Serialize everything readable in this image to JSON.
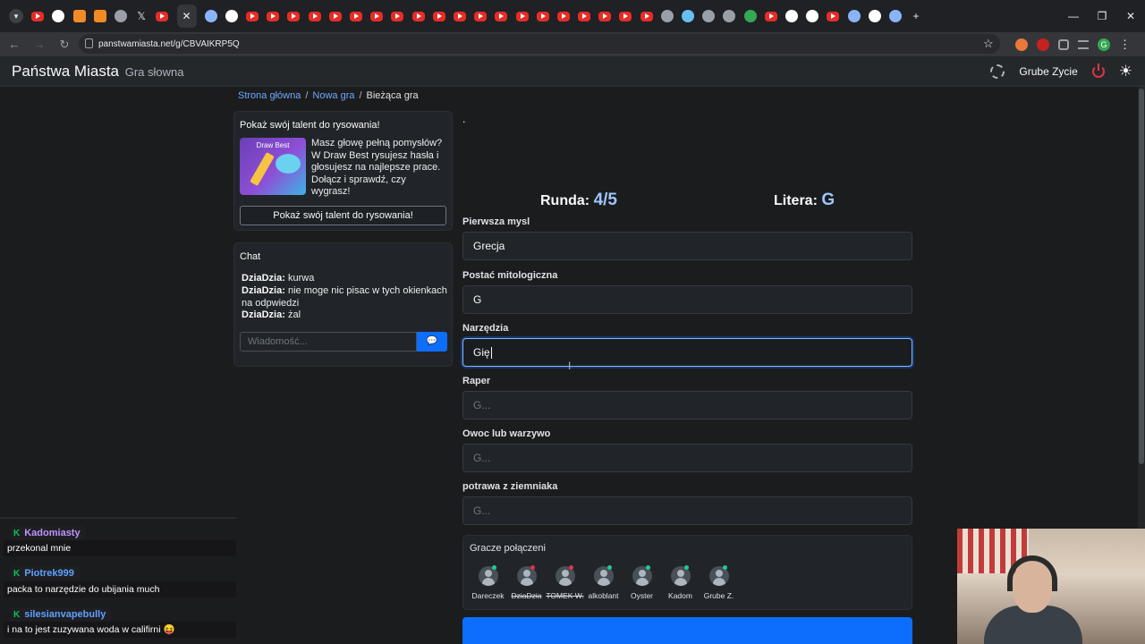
{
  "browser": {
    "url": "panstwamiasta.net/g/CBVAIKRP5Q",
    "tabs": [
      "tab-yt",
      "tab-g",
      "tab-o",
      "tab-o",
      "tab-w",
      "tab-x",
      "tab-yt",
      "tab-active",
      "tab-w",
      "tab-g"
    ]
  },
  "site": {
    "brand": "Państwa Miasta",
    "brand_sub": "Gra słowna",
    "user": "Grube Zycie"
  },
  "breadcrumb": {
    "home": "Strona główna",
    "new_game": "Nowa gra",
    "current": "Bieżąca gra"
  },
  "promo": {
    "header": "Pokaż swój talent do rysowania!",
    "image_text": "Draw Best",
    "text": "Masz głowę pełną pomysłów? W Draw Best rysujesz hasła i głosujesz na najlepsze prace. Dołącz i sprawdź, czy wygrasz!",
    "button": "Pokaż swój talent do rysowania!"
  },
  "chat": {
    "header": "Chat",
    "messages": [
      {
        "author": "DziaDzia:",
        "text": "kurwa"
      },
      {
        "author": "DziaDzia:",
        "text": "nie moge nic pisac w tych okienkach na odpwiedzi"
      },
      {
        "author": "DziaDzia:",
        "text": "żal"
      }
    ],
    "placeholder": "Wiadomość..."
  },
  "game": {
    "dot": ".",
    "round_label": "Runda:",
    "round_value": "4/5",
    "letter_label": "Litera:",
    "letter_value": "G",
    "fields": [
      {
        "label": "Pierwsza mysl",
        "value": "Grecja",
        "placeholder": ""
      },
      {
        "label": "Postać mitologiczna",
        "value": "G",
        "placeholder": ""
      },
      {
        "label": "Narzędzia",
        "value": "Gię",
        "placeholder": ""
      },
      {
        "label": "Raper",
        "value": "",
        "placeholder": "G..."
      },
      {
        "label": "Owoc lub warzywo",
        "value": "",
        "placeholder": "G..."
      },
      {
        "label": "potrawa z ziemniaka",
        "value": "",
        "placeholder": "G..."
      }
    ]
  },
  "players": {
    "header": "Gracze połączeni",
    "list": [
      {
        "name": "Dareczek",
        "status_color": "#20c997",
        "struck": false
      },
      {
        "name": "DziaDzia",
        "status_color": "#dc3545",
        "struck": true
      },
      {
        "name": "TOMEK W.",
        "status_color": "#dc3545",
        "struck": true
      },
      {
        "name": "alkoblant",
        "status_color": "#20c997",
        "struck": false
      },
      {
        "name": "Oyster",
        "status_color": "#20c997",
        "struck": false
      },
      {
        "name": "Kadom",
        "status_color": "#20c997",
        "struck": false
      },
      {
        "name": "Grube Z.",
        "status_color": "#20c997",
        "struck": false
      }
    ]
  },
  "twitch_chat": [
    {
      "user": "Kadomiasty",
      "color": "#bf94ff",
      "message": "przekonal mnie"
    },
    {
      "user": "Piotrek999",
      "color": "#5ea0ff",
      "message": "packa to narzędzie do ubijania much"
    },
    {
      "user": "silesianvapebully",
      "color": "#5ea0ff",
      "message": "i na to jest zuzywana woda w califirni 😝"
    }
  ]
}
